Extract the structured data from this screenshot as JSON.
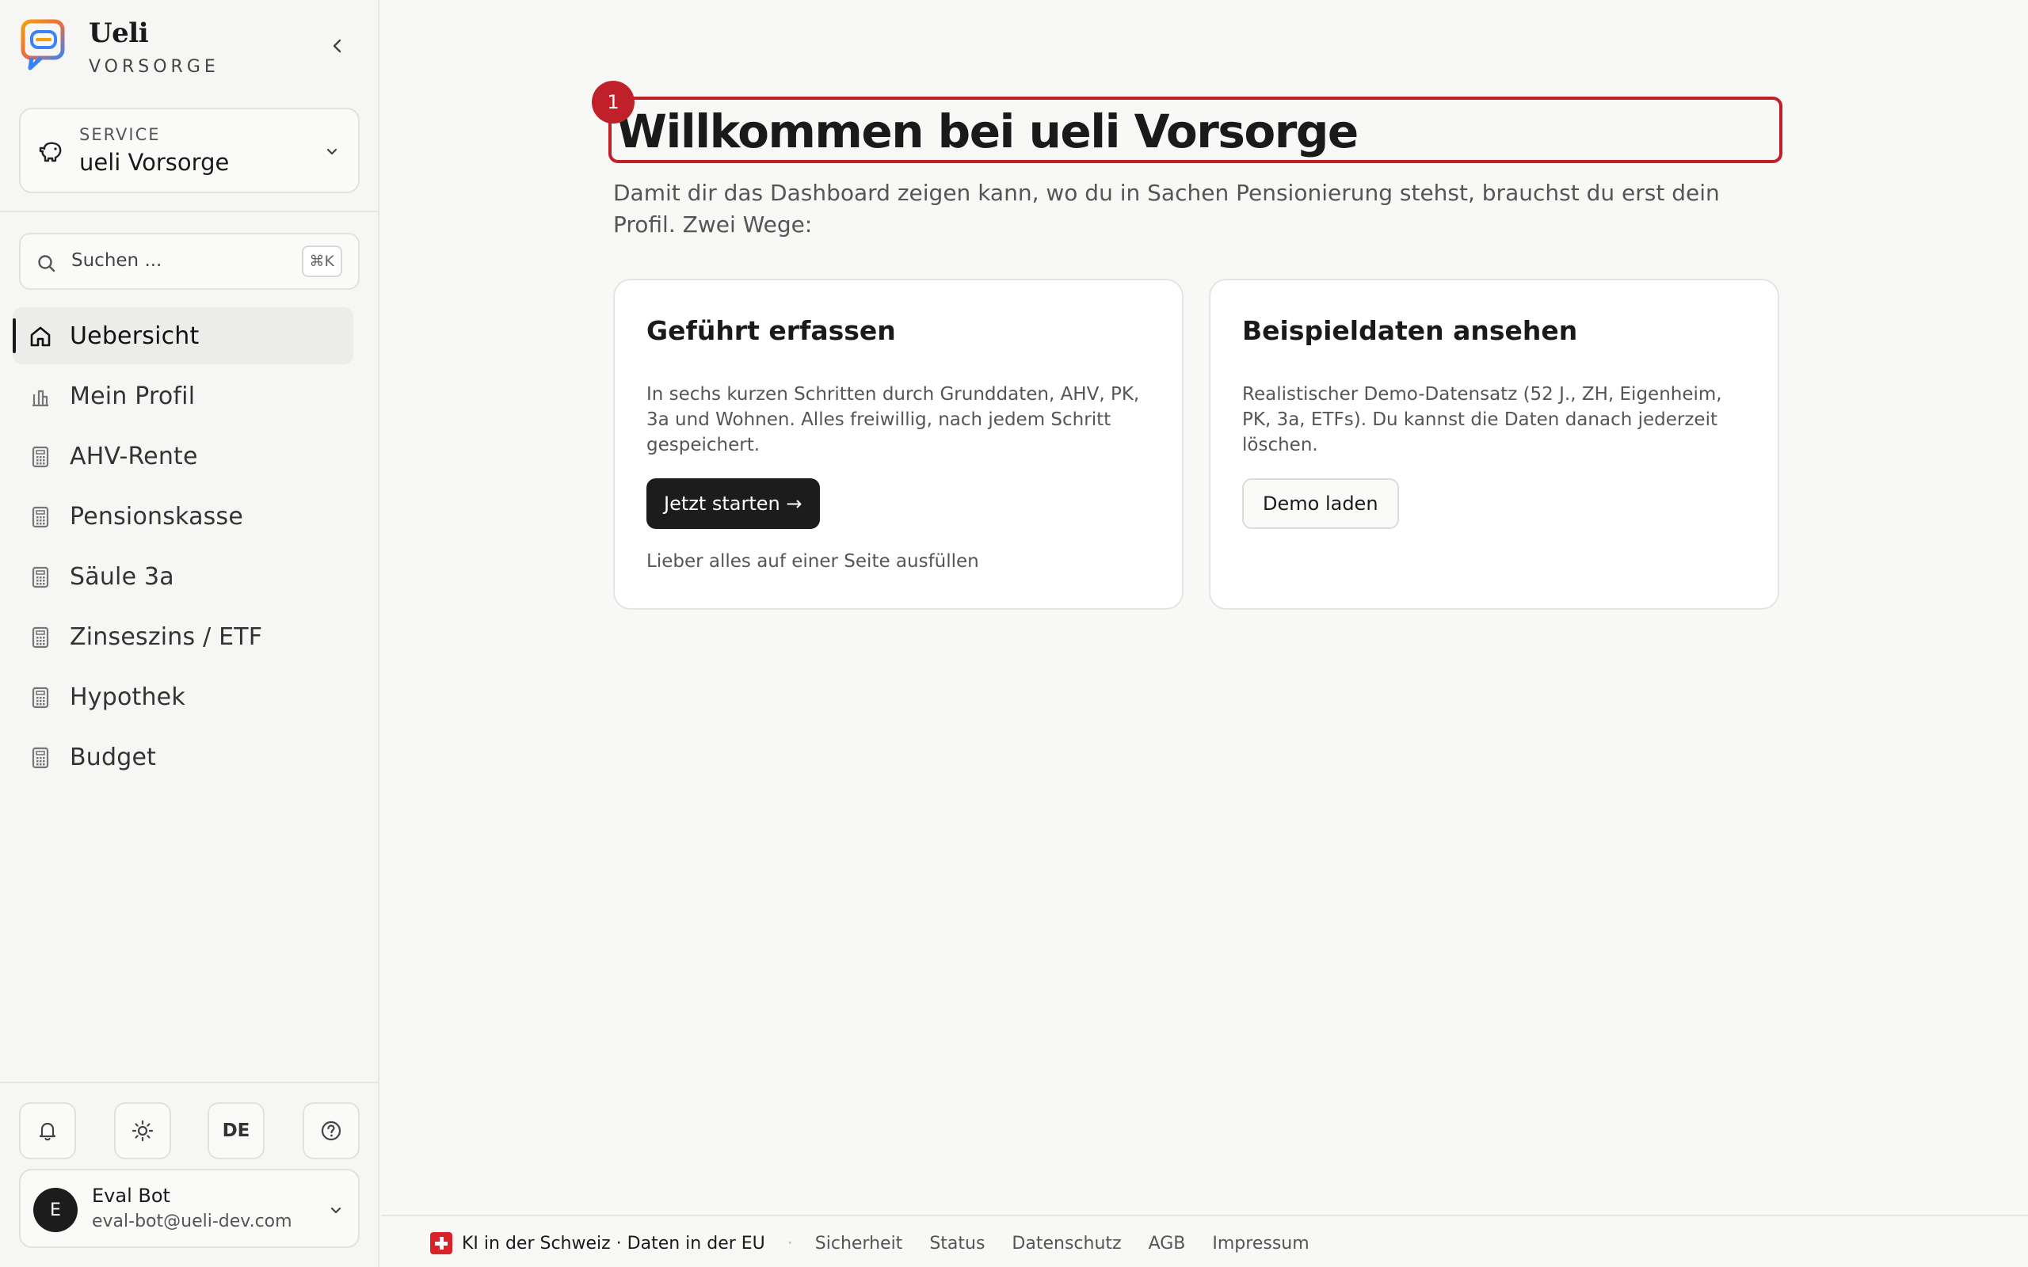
{
  "brand": {
    "name": "Ueli",
    "subtitle": "VORSORGE"
  },
  "service": {
    "label": "SERVICE",
    "value": "ueli Vorsorge"
  },
  "search": {
    "placeholder": "Suchen ...",
    "shortcut": "⌘K"
  },
  "nav": {
    "items": [
      {
        "label": "Uebersicht",
        "icon": "home-icon",
        "active": true
      },
      {
        "label": "Mein Profil",
        "icon": "bank-icon",
        "active": false
      },
      {
        "label": "AHV-Rente",
        "icon": "calculator-icon",
        "active": false
      },
      {
        "label": "Pensionskasse",
        "icon": "calculator-icon",
        "active": false
      },
      {
        "label": "Säule 3a",
        "icon": "calculator-icon",
        "active": false
      },
      {
        "label": "Zinseszins / ETF",
        "icon": "calculator-icon",
        "active": false
      },
      {
        "label": "Hypothek",
        "icon": "calculator-icon",
        "active": false
      },
      {
        "label": "Budget",
        "icon": "calculator-icon",
        "active": false
      }
    ]
  },
  "tools": {
    "language": "DE"
  },
  "user": {
    "initial": "E",
    "name": "Eval Bot",
    "email": "eval-bot@ueli-dev.com"
  },
  "main": {
    "badge": "1",
    "title": "Willkommen bei ueli Vorsorge",
    "intro": "Damit dir das Dashboard zeigen kann, wo du in Sachen Pensionierung stehst, brauchst du erst dein Profil. Zwei Wege:",
    "cards": [
      {
        "title": "Geführt erfassen",
        "text": "In sechs kurzen Schritten durch Grunddaten, AHV, PK, 3a und Wohnen. Alles freiwillig, nach jedem Schritt gespeichert.",
        "button": "Jetzt starten →",
        "link": "Lieber alles auf einer Seite ausfüllen"
      },
      {
        "title": "Beispieldaten ansehen",
        "text": "Realistischer Demo-Datensatz (52 J., ZH, Eigenheim, PK, 3a, ETFs). Du kannst die Daten danach jederzeit löschen.",
        "button": "Demo laden"
      }
    ]
  },
  "footer": {
    "claim": "KI in der Schweiz · Daten in der EU",
    "separator": "·",
    "links": [
      "Sicherheit",
      "Status",
      "Datenschutz",
      "AGB",
      "Impressum"
    ]
  },
  "colors": {
    "accent": "#c0202a",
    "dark": "#1c1c1c",
    "swiss_red": "#d8232a"
  }
}
